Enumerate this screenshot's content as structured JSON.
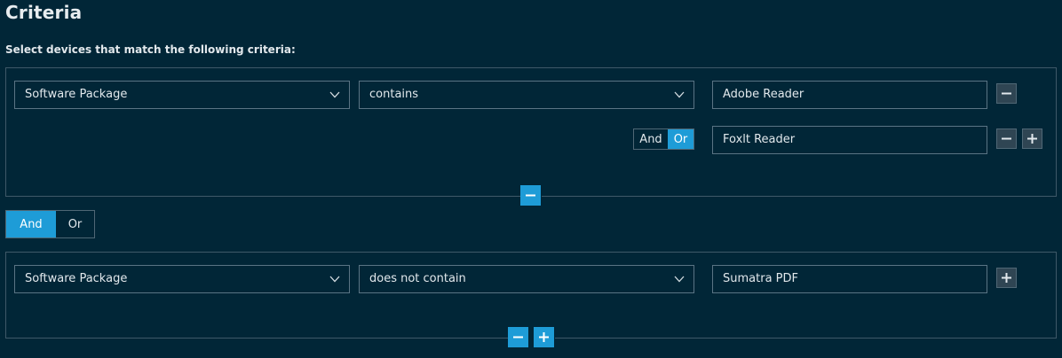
{
  "page": {
    "title": "Criteria",
    "subtitle": "Select devices that match the following criteria:"
  },
  "groups": [
    {
      "field": "Software Package",
      "operator": "contains",
      "values": [
        "Adobe Reader",
        "Foxlt Reader"
      ],
      "value_join": {
        "and": "And",
        "or": "Or",
        "selected": "Or"
      }
    },
    {
      "field": "Software Package",
      "operator": "does not contain",
      "values": [
        "Sumatra PDF"
      ]
    }
  ],
  "group_join": {
    "and": "And",
    "or": "Or",
    "selected": "And"
  },
  "icons": {
    "chevron": "chevron-down-icon",
    "minus": "minus-icon",
    "plus": "plus-icon"
  },
  "colors": {
    "background": "#012637",
    "accent": "#1e9cd7",
    "border": "#3f5968"
  }
}
